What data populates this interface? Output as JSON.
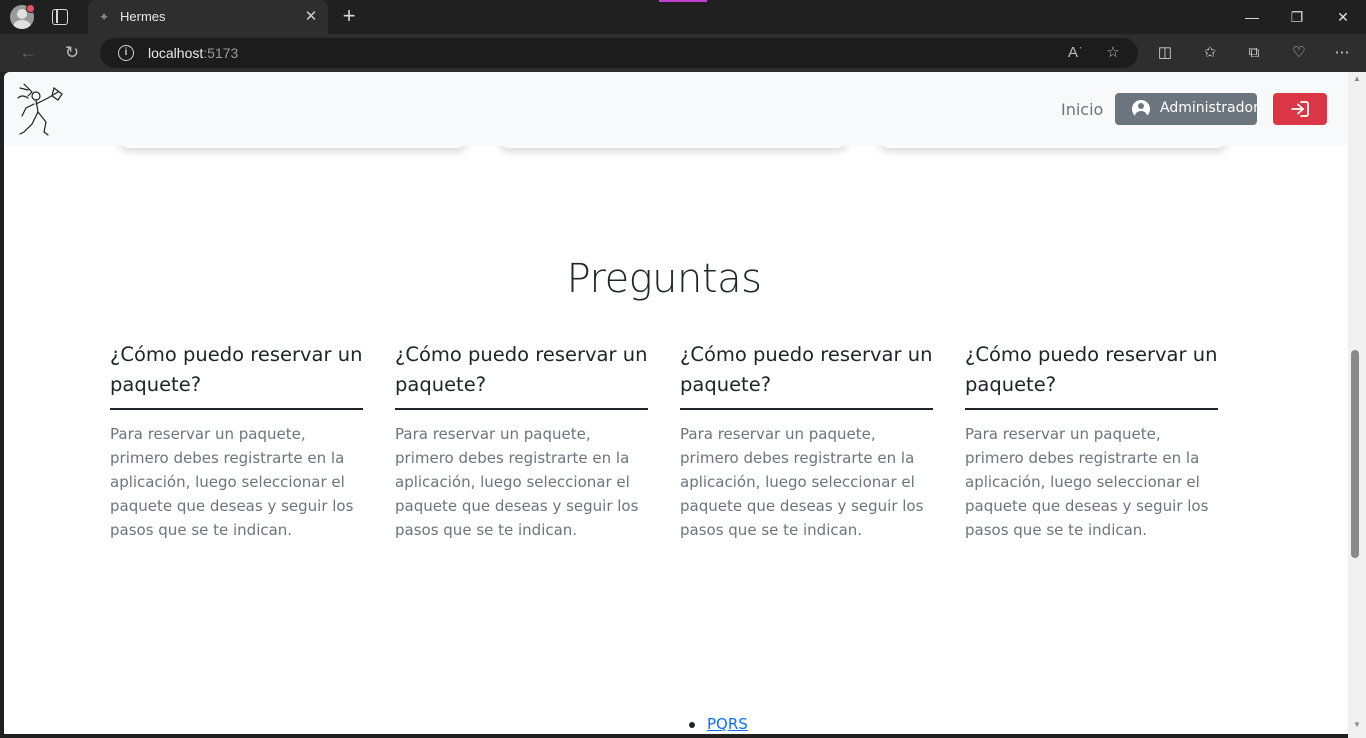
{
  "browser": {
    "tab_title": "Hermes",
    "url_host": "localhost",
    "url_port": ":5173",
    "icons": {
      "profile": "profile-avatar-icon",
      "tab_actions": "tab-actions-icon",
      "close_tab": "close-icon",
      "new_tab": "plus-icon",
      "back": "arrow-left-icon",
      "refresh": "refresh-icon",
      "site_info": "info-icon",
      "read_aloud": "read-aloud-icon",
      "favorite": "star-icon",
      "split_screen": "split-screen-icon",
      "favorites": "favorites-icon",
      "collections": "collections-icon",
      "performance": "heart-pulse-icon",
      "more": "more-icon",
      "minimize": "minimize-icon",
      "restore": "restore-icon",
      "close_window": "close-icon"
    }
  },
  "navbar": {
    "home_label": "Inicio",
    "admin_label": "Administrador",
    "accent_danger": "#dc3545",
    "accent_secondary": "#6c757d"
  },
  "faq_section": {
    "title": "Preguntas",
    "items": [
      {
        "question": "¿Cómo puedo reservar un paquete?",
        "answer": "Para reservar un paquete, primero debes registrarte en la aplicación, luego seleccionar el paquete que deseas y seguir los pasos que se te indican."
      },
      {
        "question": "¿Cómo puedo reservar un paquete?",
        "answer": "Para reservar un paquete, primero debes registrarte en la aplicación, luego seleccionar el paquete que deseas y seguir los pasos que se te indican."
      },
      {
        "question": "¿Cómo puedo reservar un paquete?",
        "answer": "Para reservar un paquete, primero debes registrarte en la aplicación, luego seleccionar el paquete que deseas y seguir los pasos que se te indican."
      },
      {
        "question": "¿Cómo puedo reservar un paquete?",
        "answer": "Para reservar un paquete, primero debes registrarte en la aplicación, luego seleccionar el paquete que deseas y seguir los pasos que se te indican."
      }
    ]
  },
  "footer": {
    "links": [
      "PQRS"
    ]
  }
}
